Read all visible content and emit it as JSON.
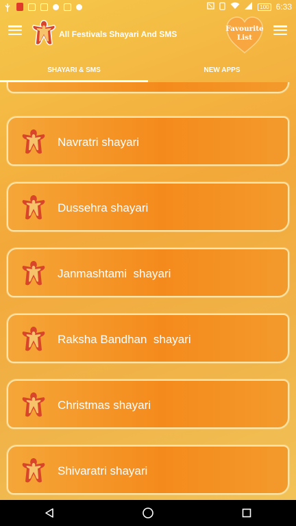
{
  "status_bar": {
    "time": "6:33",
    "battery": "100"
  },
  "app_bar": {
    "title": "All Festivals Shayari And SMS",
    "favourite_line1": "Favourite",
    "favourite_line2": "List"
  },
  "tabs": [
    {
      "label": "SHAYARI & SMS",
      "active": true
    },
    {
      "label": "NEW APPS",
      "active": false
    }
  ],
  "list": {
    "items": [
      {
        "label": ""
      },
      {
        "label": "Navratri shayari"
      },
      {
        "label": "Dussehra shayari"
      },
      {
        "label": "Janmashtami  shayari"
      },
      {
        "label": "Raksha Bandhan  shayari"
      },
      {
        "label": "Christmas shayari"
      },
      {
        "label": "Shivaratri shayari"
      }
    ]
  },
  "colors": {
    "accent": "#f58a1c",
    "card_border": "#fbe4a8",
    "heart": "#f7a640"
  },
  "icons": {
    "logo": "festival-logo-icon",
    "nav": [
      "back-icon",
      "home-icon",
      "recents-icon"
    ]
  }
}
